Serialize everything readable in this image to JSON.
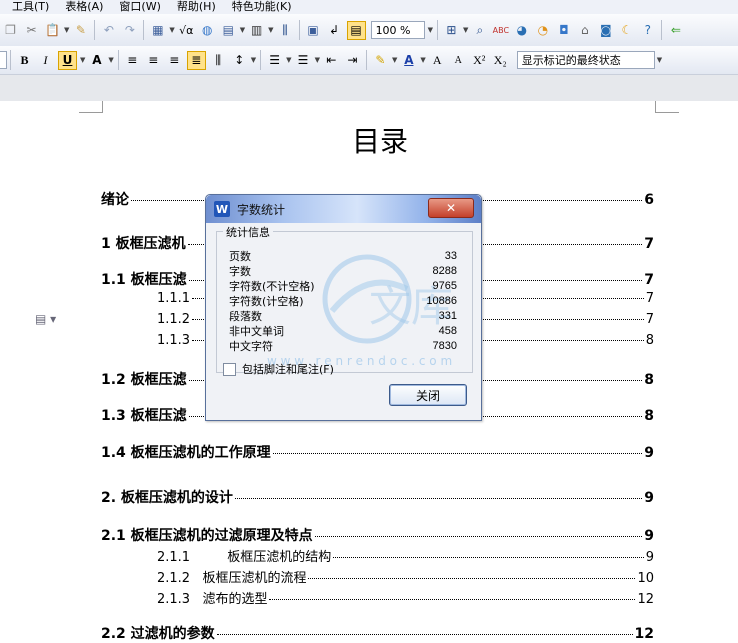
{
  "menu": {
    "items": [
      "工具(T)",
      "表格(A)",
      "窗口(W)",
      "帮助(H)",
      "特色功能(K)"
    ]
  },
  "toolbar": {
    "zoom": "100 %"
  },
  "format_bar": {
    "track_changes_mode": "显示标记的最终状态"
  },
  "toc": {
    "title": "目录",
    "entries": [
      {
        "text": "绪论",
        "page": "6"
      },
      {
        "text": "1   板框压滤机",
        "page": "7"
      },
      {
        "text": "1.1   板框压滤",
        "page": "7"
      },
      {
        "text": "1.1.1",
        "page": "7"
      },
      {
        "text": "1.1.2",
        "page": "7"
      },
      {
        "text": "1.1.3",
        "page": "8"
      },
      {
        "text": "1.2   板框压滤",
        "page": "8"
      },
      {
        "text": "1.3   板框压滤",
        "page": "8"
      },
      {
        "text": "1.4   板框压滤机的工作原理",
        "page": "9"
      },
      {
        "text": "2.   板框压滤机的设计",
        "page": "9"
      },
      {
        "text": "2.1   板框压滤机的过滤原理及特点",
        "page": "9"
      },
      {
        "text": "2.1.1         板框压滤机的结构",
        "page": "9"
      },
      {
        "text": "2.1.2   板框压滤机的流程",
        "page": "10"
      },
      {
        "text": "2.1.3   滤布的选型",
        "page": "12"
      },
      {
        "text": "2.2   过滤机的参数",
        "page": "12"
      }
    ]
  },
  "dialog": {
    "title": "字数统计",
    "close_glyph": "✕",
    "group_label": "统计信息",
    "stats": [
      {
        "label": "页数",
        "value": "33"
      },
      {
        "label": "字数",
        "value": "8288"
      },
      {
        "label": "字符数(不计空格)",
        "value": "9765"
      },
      {
        "label": "字符数(计空格)",
        "value": "10886"
      },
      {
        "label": "段落数",
        "value": "331"
      },
      {
        "label": "非中文单词",
        "value": "458"
      },
      {
        "label": "中文字符",
        "value": "7830"
      }
    ],
    "checkbox_label": "包括脚注和尾注(F)",
    "checkbox_checked": false,
    "close_button": "关闭",
    "watermark_text": "文库",
    "watermark_url": "w w w . r e n r e n d o c . c o m"
  }
}
